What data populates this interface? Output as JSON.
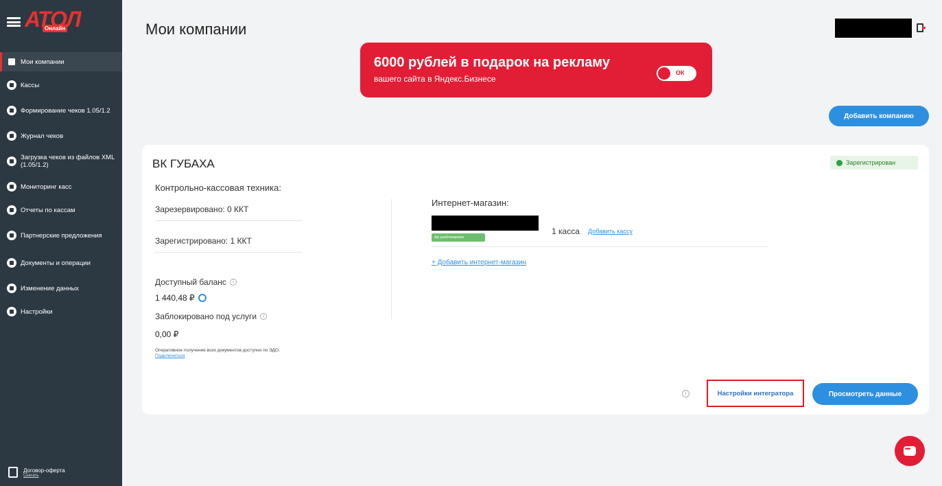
{
  "logo": {
    "text": "АТОЛ",
    "badge": "Онлайн"
  },
  "sidebar": {
    "items": [
      {
        "label": "Мои компании",
        "icon": "store-icon",
        "active": true
      },
      {
        "label": "Кассы",
        "icon": "cash-register-icon"
      },
      {
        "label": "Формирование чеков 1.05/1.2",
        "icon": "receipt-form-icon"
      },
      {
        "label": "Журнал чеков",
        "icon": "journal-icon"
      },
      {
        "label": "Загрузка чеков из файлов XML (1.05/1.2)",
        "icon": "upload-icon"
      },
      {
        "label": "Мониторинг касс",
        "icon": "monitor-icon"
      },
      {
        "label": "Отчеты по кассам",
        "icon": "report-icon"
      },
      {
        "label": "Партнерские предложения",
        "icon": "partner-icon"
      },
      {
        "label": "Документы и операции",
        "icon": "documents-icon"
      },
      {
        "label": "Изменение данных",
        "icon": "edit-icon"
      },
      {
        "label": "Настройки",
        "icon": "settings-icon"
      }
    ],
    "footer": {
      "label": "Договор-оферта",
      "link": "Скачать"
    }
  },
  "header": {
    "title": "Мои компании"
  },
  "banner": {
    "title": "6000 рублей в подарок на рекламу",
    "subtitle": "вашего сайта в Яндекс.Бизнесе",
    "toggle_label": "ОК"
  },
  "actions": {
    "add_company": "Добавить компанию"
  },
  "company": {
    "name": "ВК ГУБАХА",
    "status": "Зарегистрирован",
    "status_color": "#2ea043",
    "kkt_title": "Контрольно-кассовая техника:",
    "reserved": "Зарезервировано: 0 ККТ",
    "registered": "Зарегистрировано: 1 ККТ",
    "balance_label": "Доступный баланс",
    "balance_value": "1 440,48 ₽",
    "blocked_label": "Заблокировано под услуги",
    "blocked_value": "0,00 ₽",
    "edo_text": "Оперативное получение всех документов доступно по ЭДО.",
    "edo_link": "Подключиться",
    "shop_title": "Интернет-магазин:",
    "shop_tag": "Api разблокирован",
    "shop_count": "1 касса",
    "add_kassa": "Добавить кассу",
    "add_shop": "+ Добавить интернет-магазин",
    "integrator_settings": "Настройки интегратора",
    "view_data": "Просмотреть данные"
  },
  "colors": {
    "accent": "#2d8fe0",
    "brand": "#e8312f",
    "sidebar": "#2c3842"
  }
}
